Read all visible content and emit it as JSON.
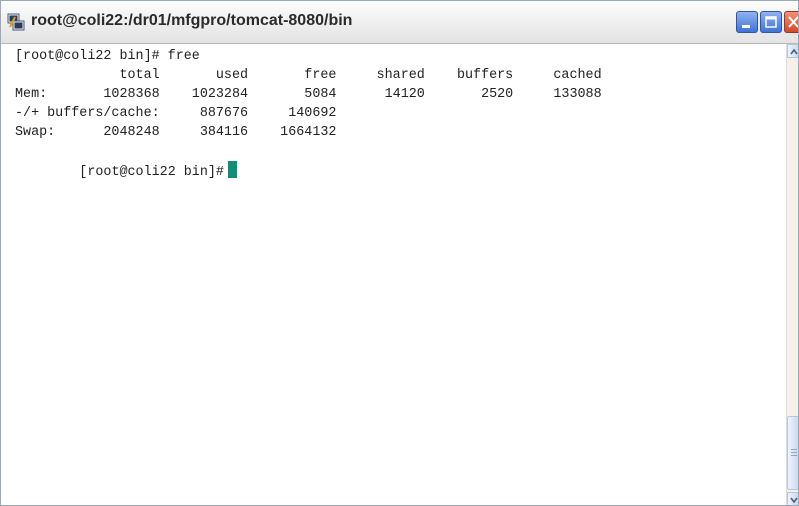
{
  "window": {
    "title": "root@coli22:/dr01/mfgpro/tomcat-8080/bin"
  },
  "terminal": {
    "lines": [
      "[root@coli22 bin]# free",
      "             total       used       free     shared    buffers     cached",
      "Mem:       1028368    1023284       5084      14120       2520     133088",
      "-/+ buffers/cache:     887676     140692",
      "Swap:      2048248     384116    1664132"
    ],
    "prompt": "[root@coli22 bin]#"
  },
  "colors": {
    "cursor": "#0f8f78",
    "text": "#222222",
    "background": "#ffffff"
  },
  "icons": {
    "app": "putty-terminal-icon",
    "minimize": "minimize-icon",
    "maximize": "maximize-icon",
    "close": "close-icon"
  }
}
